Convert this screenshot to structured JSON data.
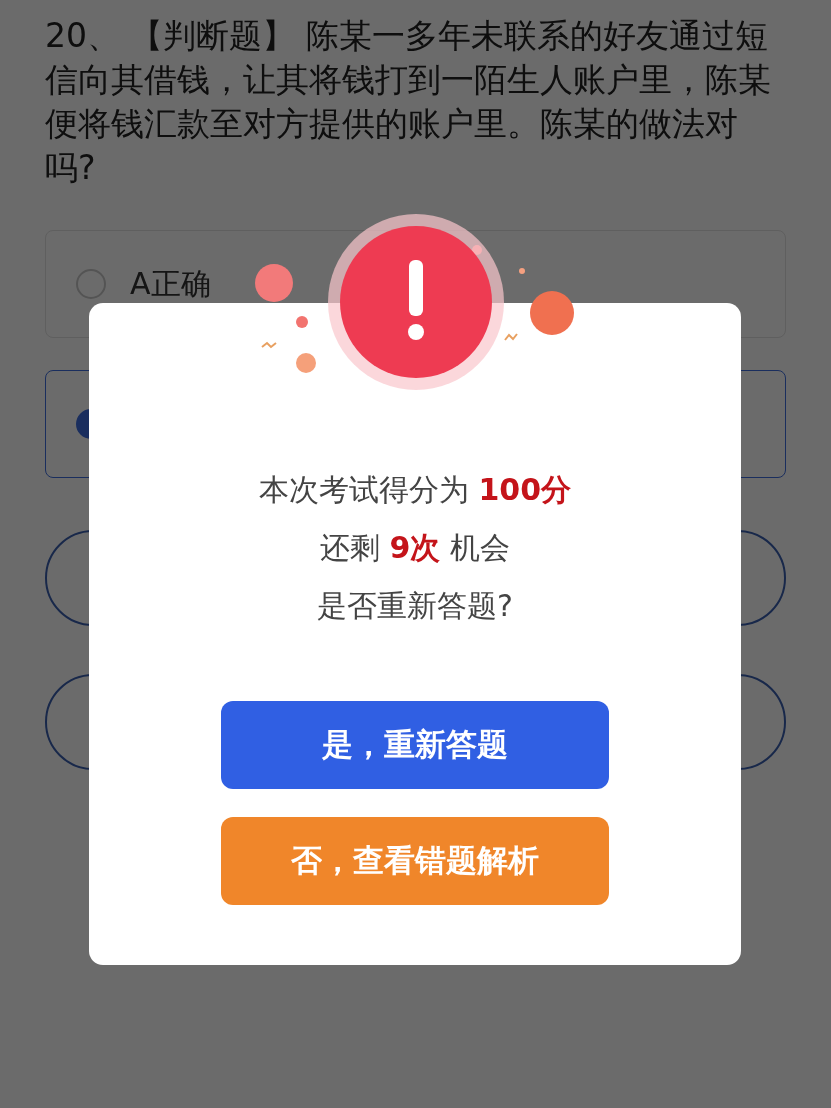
{
  "question": {
    "text": "20、 【判断题】 陈某一多年未联系的好友通过短信向其借钱，让其将钱打到一陌生人账户里，陈某便将钱汇款至对方提供的账户里。陈某的做法对吗?"
  },
  "options": [
    {
      "label": "A正确",
      "selected": false
    },
    {
      "selected": true
    }
  ],
  "dialog": {
    "lines": [
      "本次考试得分为 **100分**",
      "还剩 **9次** 机会",
      "是否重新答题?"
    ],
    "buttons": [
      {
        "label": "是，重新答题",
        "kind": "primary"
      },
      {
        "label": "否，查看错题解析",
        "kind": "secondary"
      }
    ]
  }
}
